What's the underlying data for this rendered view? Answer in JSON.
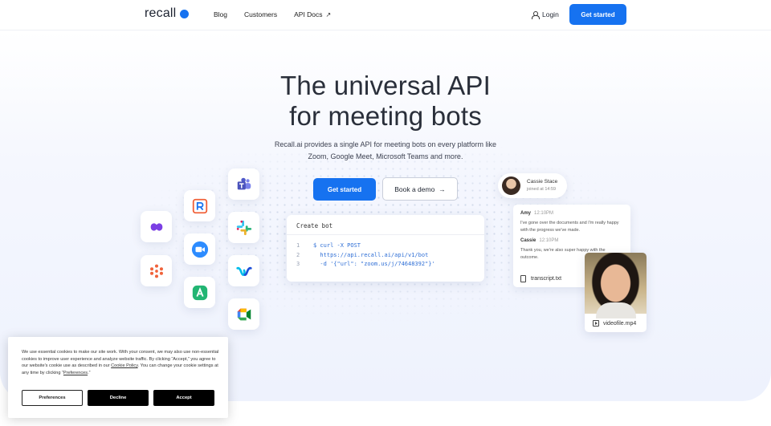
{
  "nav": {
    "logo_text": "recall",
    "links": [
      "Blog",
      "Customers",
      "API Docs"
    ],
    "api_docs_arrow": "↗",
    "login": "Login",
    "cta": "Get started"
  },
  "hero": {
    "title_line1": "The universal API",
    "title_line2": "for meeting bots",
    "subtitle_line1": "Recall.ai provides a single API for meeting bots on every platform like",
    "subtitle_line2": "Zoom, Google Meet, Microsoft Teams and more.",
    "primary_button": "Get started",
    "secondary_button": "Book a demo",
    "secondary_arrow": "→"
  },
  "code": {
    "title": "Create bot",
    "lines": [
      {
        "n": "1",
        "text": "$ curl -X POST"
      },
      {
        "n": "2",
        "text": "  https://api.recall.ai/api/v1/bot"
      },
      {
        "n": "3",
        "text": "  -d '{\"url\": \"zoom.us/j/74648392\"}'"
      }
    ]
  },
  "apps": [
    "dialpad-icon",
    "asana-icon",
    "recall-r-icon",
    "zoom-icon",
    "copilot-icon",
    "teams-icon",
    "slack-icon",
    "webex-icon",
    "google-meet-icon"
  ],
  "participant": {
    "name": "Cassie Stace",
    "joined": "joined at 14:59"
  },
  "chat": {
    "messages": [
      {
        "name": "Amy",
        "time": "12:10PM",
        "text": "I've gone over the documents and I'm really happy with the progress we've made."
      },
      {
        "name": "Cassie",
        "time": "12:10PM",
        "text": "Thank you, we're also super happy with the outcome."
      }
    ],
    "file": "transcript.txt"
  },
  "video": {
    "file": "videofile.mp4"
  },
  "cookie": {
    "text_before_link": "We use essential cookies to make our site work. With your consent, we may also use non-essential cookies to improve user experience and analyze website traffic. By clicking “Accept,” you agree to our website's cookie use as described in our ",
    "link": "Cookie Policy",
    "text_mid": ". You can change your cookie settings at any time by clicking “",
    "pref_link": "Preferences",
    "text_end": ".”",
    "preferences": "Preferences",
    "decline": "Decline",
    "accept": "Accept"
  },
  "colors": {
    "brand": "#1672f0",
    "text": "#2a2f3a"
  }
}
